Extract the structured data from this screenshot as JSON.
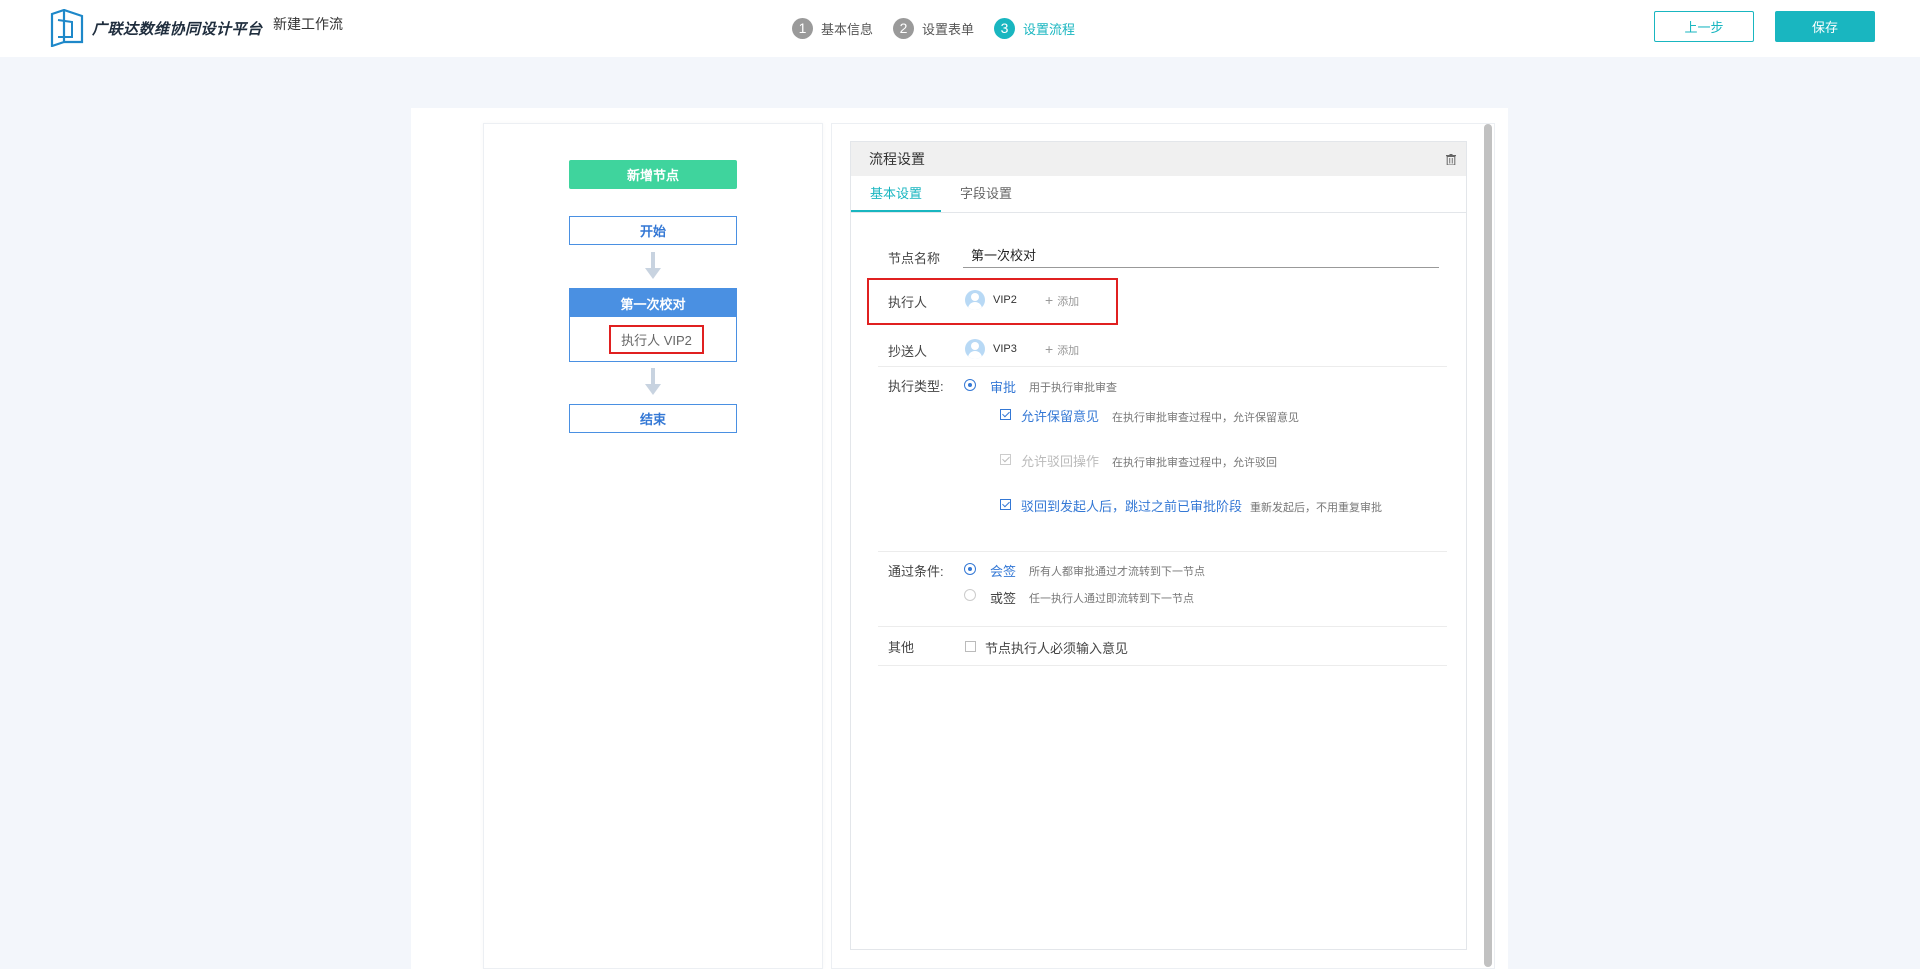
{
  "header": {
    "brand": "广联达数维协同设计平台",
    "page_name": "新建工作流",
    "steps": [
      {
        "num": "1",
        "label": "基本信息"
      },
      {
        "num": "2",
        "label": "设置表单"
      },
      {
        "num": "3",
        "label": "设置流程"
      }
    ],
    "prev_label": "上一步",
    "save_label": "保存"
  },
  "flow": {
    "add_node_label": "新增节点",
    "start_label": "开始",
    "node_title": "第一次校对",
    "node_executor": "执行人 VIP2",
    "end_label": "结束"
  },
  "settings": {
    "title": "流程设置",
    "tabs": [
      "基本设置",
      "字段设置"
    ],
    "node_name_label": "节点名称",
    "node_name_value": "第一次校对",
    "executor_label": "执行人",
    "executor_name": "VIP2",
    "cc_label": "抄送人",
    "cc_name": "VIP3",
    "add_label": "添加",
    "exec_type_label": "执行类型:",
    "exec_type_option": "审批",
    "exec_type_hint": "用于执行审批审查",
    "checks": [
      {
        "label": "允许保留意见",
        "hint": "在执行审批审查过程中，允许保留意见"
      },
      {
        "label": "允许驳回操作",
        "hint": "在执行审批审查过程中，允许驳回"
      },
      {
        "label": "驳回到发起人后，跳过之前已审批阶段",
        "hint": "重新发起后，不用重复审批"
      }
    ],
    "pass_label": "通过条件:",
    "pass_options": [
      {
        "label": "会签",
        "hint": "所有人都审批通过才流转到下一节点"
      },
      {
        "label": "或签",
        "hint": "任一执行人通过即流转到下一节点"
      }
    ],
    "other_label": "其他",
    "other_option": "节点执行人必须输入意见"
  },
  "colors": {
    "accent": "#19b6c0",
    "node_blue": "#4a90e2",
    "add_green": "#3fd49d",
    "highlight_red": "#e02020"
  }
}
